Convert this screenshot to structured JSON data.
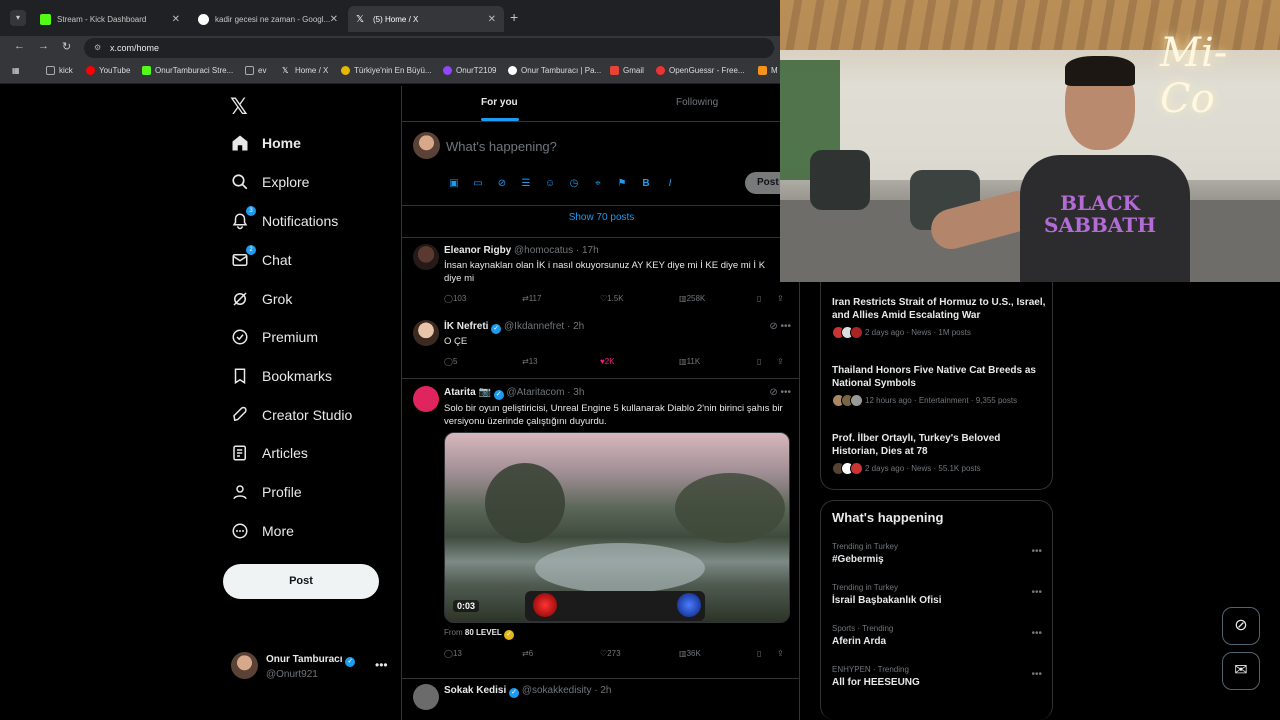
{
  "browser": {
    "tabs": [
      {
        "title": "Stream - Kick Dashboard"
      },
      {
        "title": "kadir gecesi ne zaman - Googl..."
      },
      {
        "title": "(5) Home / X"
      }
    ],
    "url": "x.com/home",
    "bookmarks": [
      "kick",
      "YouTube",
      "OnurTamburaci Stre...",
      "ev",
      "Home / X",
      "Türkiye'nin En Büyü...",
      "OnurT2109",
      "Onur Tamburacı | Pa...",
      "Gmail",
      "OpenGuessr - Free...",
      "M"
    ]
  },
  "sidebar": {
    "items": [
      {
        "label": "Home"
      },
      {
        "label": "Explore"
      },
      {
        "label": "Notifications",
        "badge": "3"
      },
      {
        "label": "Chat",
        "badge": "2"
      },
      {
        "label": "Grok"
      },
      {
        "label": "Premium"
      },
      {
        "label": "Bookmarks"
      },
      {
        "label": "Creator Studio"
      },
      {
        "label": "Articles"
      },
      {
        "label": "Profile"
      },
      {
        "label": "More"
      }
    ],
    "post_label": "Post",
    "account": {
      "name": "Onur Tamburacı",
      "handle": "@Onurt921"
    }
  },
  "feed": {
    "tabs": {
      "for_you": "For you",
      "following": "Following"
    },
    "compose_placeholder": "What's happening?",
    "compose_post": "Post",
    "show_posts": "Show 70 posts",
    "tweets": [
      {
        "name": "Eleanor Rigby",
        "handle": "@homocatus",
        "time": "· 17h",
        "text": "İnsan kaynakları olan İK i nasıl okuyorsunuz AY KEY diye mi İ KE diye mi İ K diye mi",
        "replies": "103",
        "reposts": "117",
        "likes": "1.5K",
        "views": "258K"
      },
      {
        "name": "İK Nefreti",
        "handle": "@Ikdannefret",
        "time": "· 2h",
        "text": "O ÇE",
        "replies": "5",
        "reposts": "13",
        "likes": "2K",
        "views": "11K"
      },
      {
        "name": "Atarita 📷",
        "handle": "@Ataritacom",
        "time": "· 3h",
        "text": "Solo bir oyun geliştiricisi, Unreal Engine 5 kullanarak Diablo 2'nin birinci şahıs bir versiyonu üzerinde çalıştığını duyurdu.",
        "video_duration": "0:03",
        "from_label": "From",
        "from_source": "80 LEVEL",
        "replies": "13",
        "reposts": "6",
        "likes": "273",
        "views": "36K"
      },
      {
        "name": "Sokak Kedisi",
        "handle": "@sokakkedisity",
        "time": "· 2h"
      }
    ]
  },
  "news": [
    {
      "title": "Iran Restricts Strait of Hormuz to U.S., Israel, and Allies Amid Escalating War",
      "meta": "2 days ago · News · 1M posts"
    },
    {
      "title": "Thailand Honors Five Native Cat Breeds as National Symbols",
      "meta": "12 hours ago · Entertainment · 9,355 posts"
    },
    {
      "title": "Prof. İlber Ortaylı, Turkey's Beloved Historian, Dies at 78",
      "meta": "2 days ago · News · 55.1K posts"
    }
  ],
  "whats_happening": {
    "title": "What's happening",
    "trends": [
      {
        "context": "Trending in Turkey",
        "name": "#Gebermiş"
      },
      {
        "context": "Trending in Turkey",
        "name": "İsrail Başbakanlık Ofisi"
      },
      {
        "context": "Sports · Trending",
        "name": "Aferin Arda"
      },
      {
        "context": "ENHYPEN · Trending",
        "name": "All for HEESEUNG"
      }
    ]
  },
  "webcam": {
    "neon_text": "Mi-Co",
    "shirt_text": "BLACK SABBATH"
  },
  "colors": {
    "accent": "#1d9bf0",
    "like": "#f91880",
    "background": "#000000"
  }
}
